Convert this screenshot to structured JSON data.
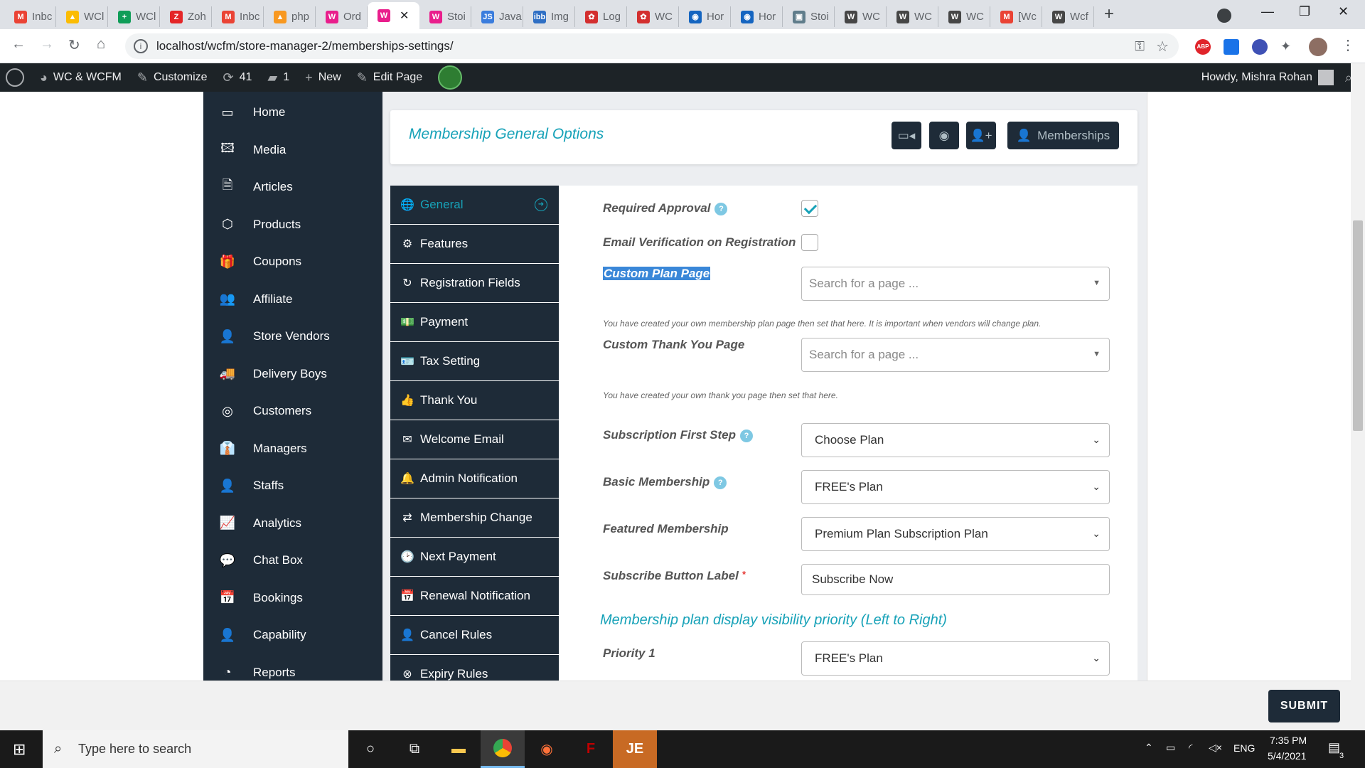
{
  "browser": {
    "tabs": [
      {
        "label": "Inbc",
        "color": "#ea4335",
        "glyph": "M"
      },
      {
        "label": "WCl",
        "color": "#fbbc04",
        "glyph": "▲"
      },
      {
        "label": "WCl",
        "color": "#0f9d58",
        "glyph": "+"
      },
      {
        "label": "Zoh",
        "color": "#e42527",
        "glyph": "Z"
      },
      {
        "label": "Inbc",
        "color": "#ea4335",
        "glyph": "M"
      },
      {
        "label": "php",
        "color": "#f89820",
        "glyph": "▲"
      },
      {
        "label": "Ord",
        "color": "#e91e8c",
        "glyph": "W"
      },
      {
        "label": "",
        "color": "#e91e8c",
        "glyph": "W",
        "active": true
      },
      {
        "label": "Stoi",
        "color": "#e91e8c",
        "glyph": "W"
      },
      {
        "label": "Java",
        "color": "#3b7ddd",
        "glyph": "JS"
      },
      {
        "label": "Img",
        "color": "#2f6fc4",
        "glyph": "ibb"
      },
      {
        "label": "Log",
        "color": "#d32f2f",
        "glyph": "✿"
      },
      {
        "label": "WC",
        "color": "#d32f2f",
        "glyph": "✿"
      },
      {
        "label": "Hor",
        "color": "#1565c0",
        "glyph": "◉"
      },
      {
        "label": "Hor",
        "color": "#1565c0",
        "glyph": "◉"
      },
      {
        "label": "Stoi",
        "color": "#607d8b",
        "glyph": "▣"
      },
      {
        "label": "WC",
        "color": "#464646",
        "glyph": "W"
      },
      {
        "label": "WC",
        "color": "#464646",
        "glyph": "W"
      },
      {
        "label": "WC",
        "color": "#464646",
        "glyph": "W"
      },
      {
        "label": "[Wc",
        "color": "#ea4335",
        "glyph": "M"
      },
      {
        "label": "Wcf",
        "color": "#464646",
        "glyph": "W"
      }
    ],
    "url": "localhost/wcfm/store-manager-2/memberships-settings/"
  },
  "adminbar": {
    "site": "WC & WCFM",
    "customize": "Customize",
    "updates": "41",
    "comments": "1",
    "new": "New",
    "edit": "Edit Page",
    "howdy": "Howdy, Mishra Rohan"
  },
  "sidebar": {
    "items": [
      {
        "label": "Home",
        "icon": "monitor-icon",
        "glyph": "▭"
      },
      {
        "label": "Media",
        "icon": "image-icon",
        "glyph": "🖾"
      },
      {
        "label": "Articles",
        "icon": "document-icon",
        "glyph": "🗎"
      },
      {
        "label": "Products",
        "icon": "cube-icon",
        "glyph": "⬡"
      },
      {
        "label": "Coupons",
        "icon": "gift-icon",
        "glyph": "🎁"
      },
      {
        "label": "Affiliate",
        "icon": "users-icon",
        "glyph": "👥"
      },
      {
        "label": "Store Vendors",
        "icon": "user-icon",
        "glyph": "👤"
      },
      {
        "label": "Delivery Boys",
        "icon": "truck-icon",
        "glyph": "🚚"
      },
      {
        "label": "Customers",
        "icon": "user-circle-icon",
        "glyph": "◎"
      },
      {
        "label": "Managers",
        "icon": "user-tie-icon",
        "glyph": "👔"
      },
      {
        "label": "Staffs",
        "icon": "user-icon",
        "glyph": "👤"
      },
      {
        "label": "Analytics",
        "icon": "chart-line-icon",
        "glyph": "📈"
      },
      {
        "label": "Chat Box",
        "icon": "comments-icon",
        "glyph": "💬"
      },
      {
        "label": "Bookings",
        "icon": "calendar-icon",
        "glyph": "📅"
      },
      {
        "label": "Capability",
        "icon": "user-times-icon",
        "glyph": "👤"
      },
      {
        "label": "Reports",
        "icon": "pie-chart-icon",
        "glyph": "◔"
      }
    ]
  },
  "header": {
    "title": "Membership General Options",
    "memberships_label": "Memberships"
  },
  "submenu": {
    "items": [
      {
        "label": "General",
        "icon": "globe-icon",
        "glyph": "🌐",
        "active": true
      },
      {
        "label": "Features",
        "icon": "cog-icon",
        "glyph": "⚙"
      },
      {
        "label": "Registration Fields",
        "icon": "refresh-icon",
        "glyph": "↻"
      },
      {
        "label": "Payment",
        "icon": "money-icon",
        "glyph": "💵"
      },
      {
        "label": "Tax Setting",
        "icon": "id-card-icon",
        "glyph": "🪪"
      },
      {
        "label": "Thank You",
        "icon": "thumbs-up-icon",
        "glyph": "👍"
      },
      {
        "label": "Welcome Email",
        "icon": "envelope-icon",
        "glyph": "✉"
      },
      {
        "label": "Admin Notification",
        "icon": "bell-icon",
        "glyph": "🔔"
      },
      {
        "label": "Membership Change",
        "icon": "exchange-icon",
        "glyph": "⇄"
      },
      {
        "label": "Next Payment",
        "icon": "clock-icon",
        "glyph": "🕑"
      },
      {
        "label": "Renewal Notification",
        "icon": "calendar-icon",
        "glyph": "📅"
      },
      {
        "label": "Cancel Rules",
        "icon": "user-times-icon",
        "glyph": "👤"
      },
      {
        "label": "Expiry Rules",
        "icon": "times-circle-icon",
        "glyph": "⊗"
      }
    ]
  },
  "form": {
    "required_approval": {
      "label": "Required Approval",
      "checked": true
    },
    "email_verification": {
      "label": "Email Verification on Registration",
      "checked": false
    },
    "custom_plan_page": {
      "label": "Custom Plan Page",
      "placeholder": "Search for a page ...",
      "desc": "You have created your own membership plan page then set that here. It is important when vendors will change plan."
    },
    "custom_thank_you_page": {
      "label": "Custom Thank You Page",
      "placeholder": "Search for a page ...",
      "desc": "You have created your own thank you page then set that here."
    },
    "subscription_first_step": {
      "label": "Subscription First Step",
      "value": "Choose Plan"
    },
    "basic_membership": {
      "label": "Basic Membership",
      "value": "FREE's Plan"
    },
    "featured_membership": {
      "label": "Featured Membership",
      "value": "Premium Plan Subscription Plan"
    },
    "subscribe_button_label": {
      "label": "Subscribe Button Label",
      "required_mark": "*",
      "value": "Subscribe Now"
    },
    "section_title": "Membership plan display visibility priority (Left to Right)",
    "priority1": {
      "label": "Priority 1",
      "value": "FREE's Plan"
    }
  },
  "submit_label": "SUBMIT",
  "taskbar": {
    "search_placeholder": "Type here to search",
    "lang": "ENG",
    "time": "7:35 PM",
    "date": "5/4/2021",
    "notifications": "3"
  }
}
